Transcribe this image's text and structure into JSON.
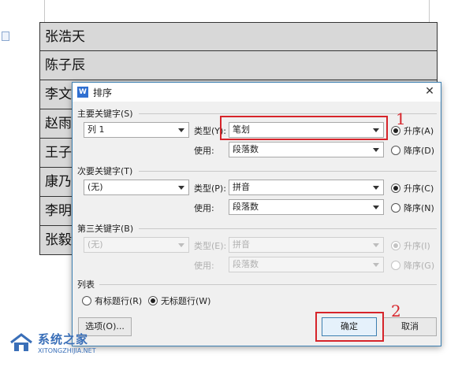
{
  "document": {
    "rows": [
      "张浩天",
      "陈子辰",
      "李文",
      "赵雨",
      "王子",
      "康乃",
      "李明",
      "张毅"
    ]
  },
  "dialog": {
    "title": "排序",
    "close_glyph": "✕",
    "primary": {
      "label": "主要关键字(S)",
      "field": "列 1",
      "type_label": "类型(Y):",
      "type_value": "笔划",
      "use_label": "使用:",
      "use_value": "段落数",
      "asc_label": "升序(A)",
      "desc_label": "降序(D)",
      "asc_selected": true
    },
    "secondary": {
      "label": "次要关键字(T)",
      "field": "(无)",
      "type_label": "类型(P):",
      "type_value": "拼音",
      "use_label": "使用:",
      "use_value": "段落数",
      "asc_label": "升序(C)",
      "desc_label": "降序(N)",
      "asc_selected": true
    },
    "tertiary": {
      "label": "第三关键字(B)",
      "field": "(无)",
      "type_label": "类型(E):",
      "type_value": "拼音",
      "use_label": "使用:",
      "use_value": "段落数",
      "asc_label": "升序(I)",
      "desc_label": "降序(G)",
      "asc_selected": true,
      "disabled": true
    },
    "list": {
      "label": "列表",
      "with_header": "有标题行(R)",
      "without_header": "无标题行(W)",
      "selected": "without_header"
    },
    "buttons": {
      "options": "选项(O)...",
      "ok": "确定",
      "cancel": "取消"
    }
  },
  "annotations": {
    "marker_1": "1",
    "marker_2": "2",
    "color": "#d6242a"
  },
  "watermark": {
    "cn": "系统之家",
    "en": "XITONGZHIJIA.NET"
  },
  "colors": {
    "accent": "#3c7fb1",
    "row_bg": "#d8d8d8"
  }
}
